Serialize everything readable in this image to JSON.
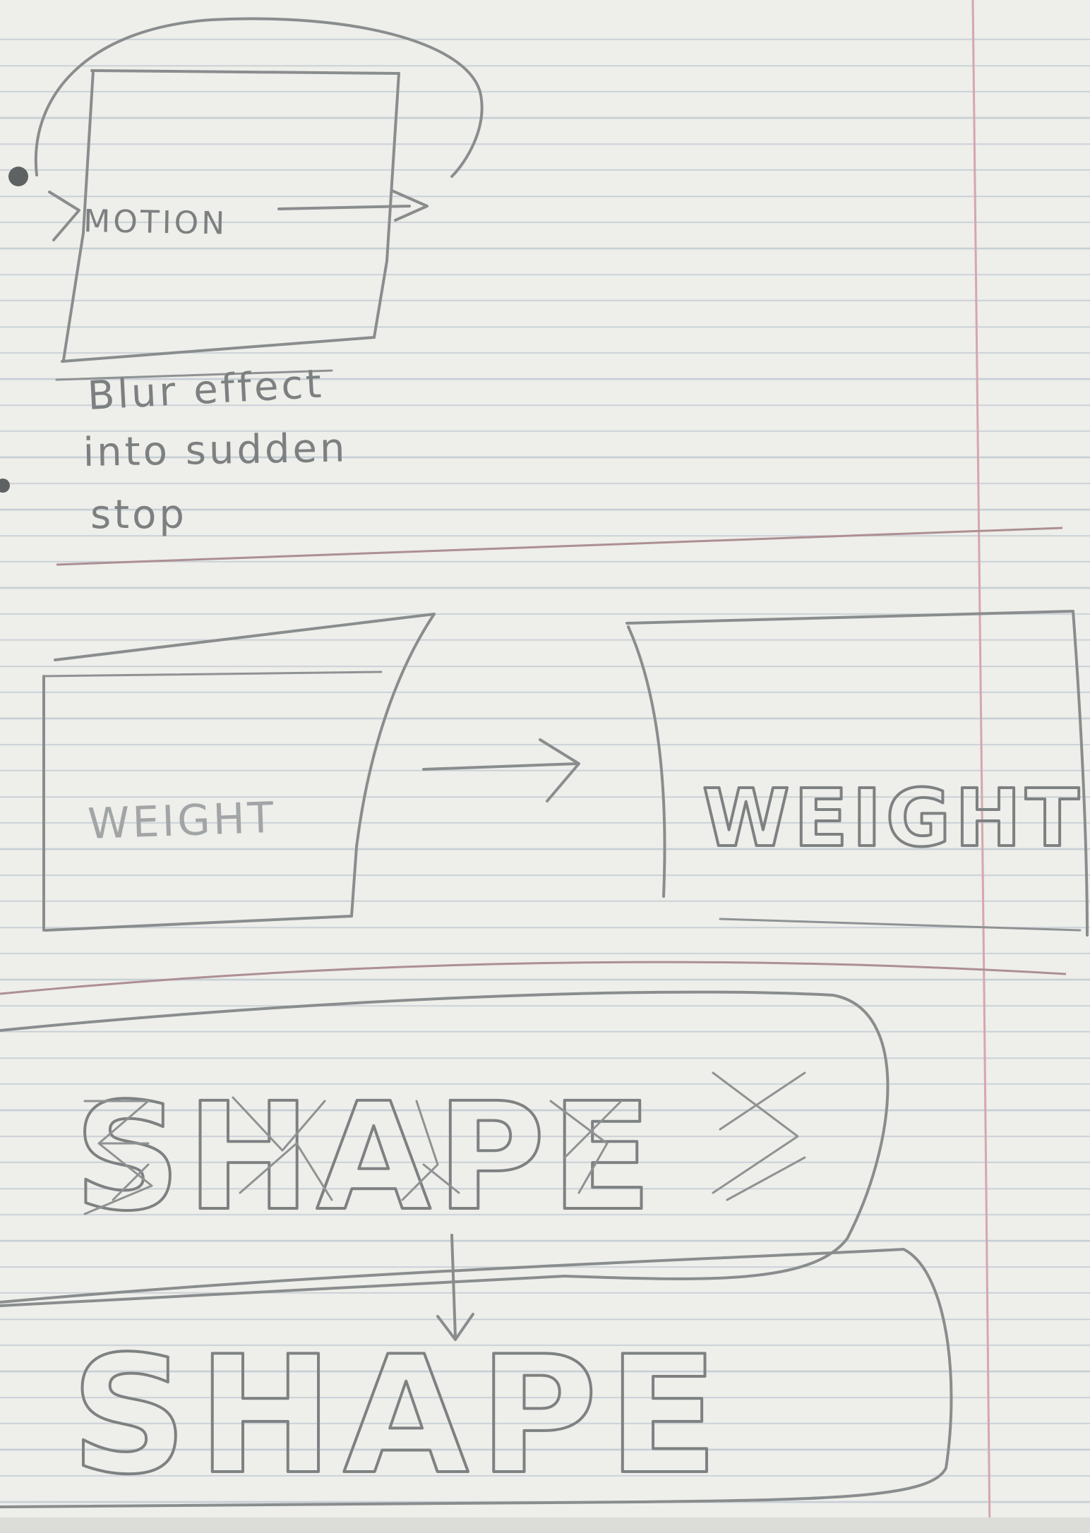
{
  "sketch": {
    "motion_label": "MOTION",
    "motion_note_line1": "Blur effect",
    "motion_note_line2": "into sudden",
    "motion_note_line3": "stop",
    "weight_before": "WEIGHT",
    "weight_after": "WEIGHT",
    "shape_fragmented": "SHAPE",
    "shape_solid": "SHAPE"
  },
  "colors": {
    "paper": "#eeeeea",
    "rule_lines": "#c7cfd6",
    "margin_line": "#d6a6ae",
    "pencil": "#8a8d8e"
  }
}
